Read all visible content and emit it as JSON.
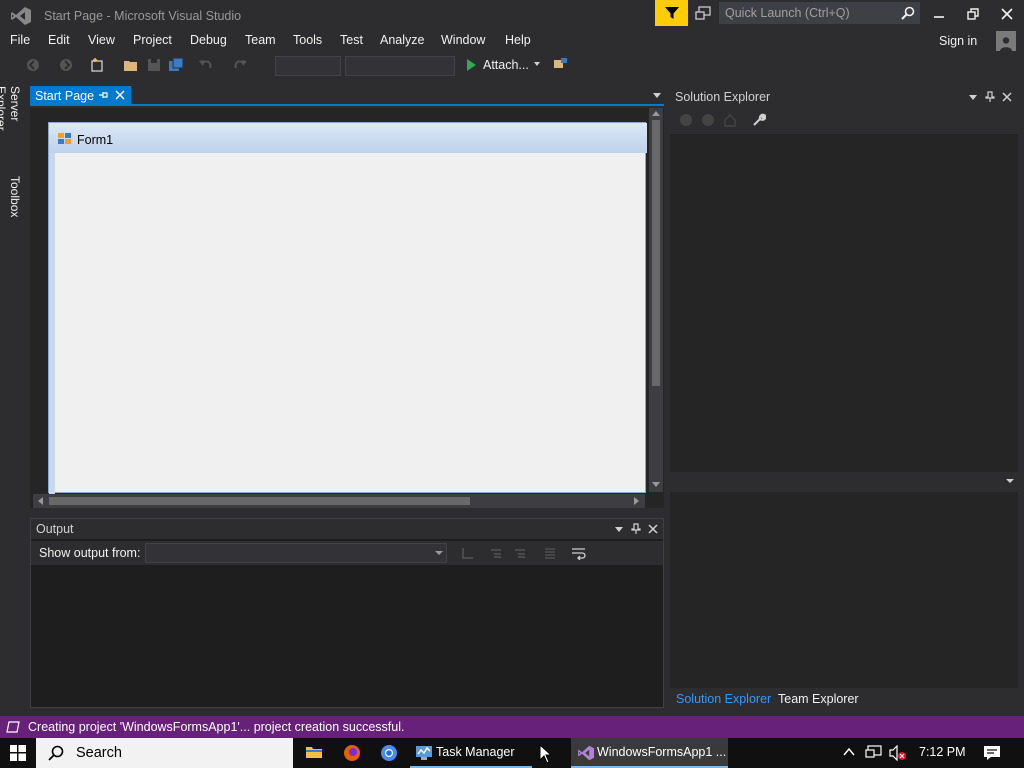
{
  "window": {
    "title": "Start Page - Microsoft Visual Studio",
    "quick_launch_placeholder": "Quick Launch (Ctrl+Q)",
    "sign_in": "Sign in"
  },
  "menu": [
    "File",
    "Edit",
    "View",
    "Project",
    "Debug",
    "Team",
    "Tools",
    "Test",
    "Analyze",
    "Window",
    "Help"
  ],
  "toolbar": {
    "attach_label": "Attach...",
    "icons": [
      "back-icon",
      "forward-icon",
      "new-project-icon",
      "open-file-icon",
      "save-icon",
      "save-all-icon",
      "undo-icon",
      "redo-icon",
      "start-icon",
      "dock-icon"
    ]
  },
  "side_tabs": [
    "Server Explorer",
    "Toolbox"
  ],
  "document_tab": {
    "label": "Start Page"
  },
  "designer": {
    "form_title": "Form1"
  },
  "output": {
    "title": "Output",
    "show_output_from": "Show output from:",
    "source_value": ""
  },
  "solution_explorer": {
    "title": "Solution Explorer",
    "tabs": [
      "Solution Explorer",
      "Team Explorer"
    ]
  },
  "status": {
    "text": "Creating project 'WindowsFormsApp1'... project creation successful."
  },
  "taskbar": {
    "search_label": "Search",
    "apps": [
      "Task Manager",
      "WindowsFormsApp1 ..."
    ],
    "time": "7:12 PM"
  },
  "colors": {
    "accent": "#007acc",
    "status_bar": "#68217a",
    "feedback": "#ffcc00",
    "background": "#2d2d30"
  }
}
